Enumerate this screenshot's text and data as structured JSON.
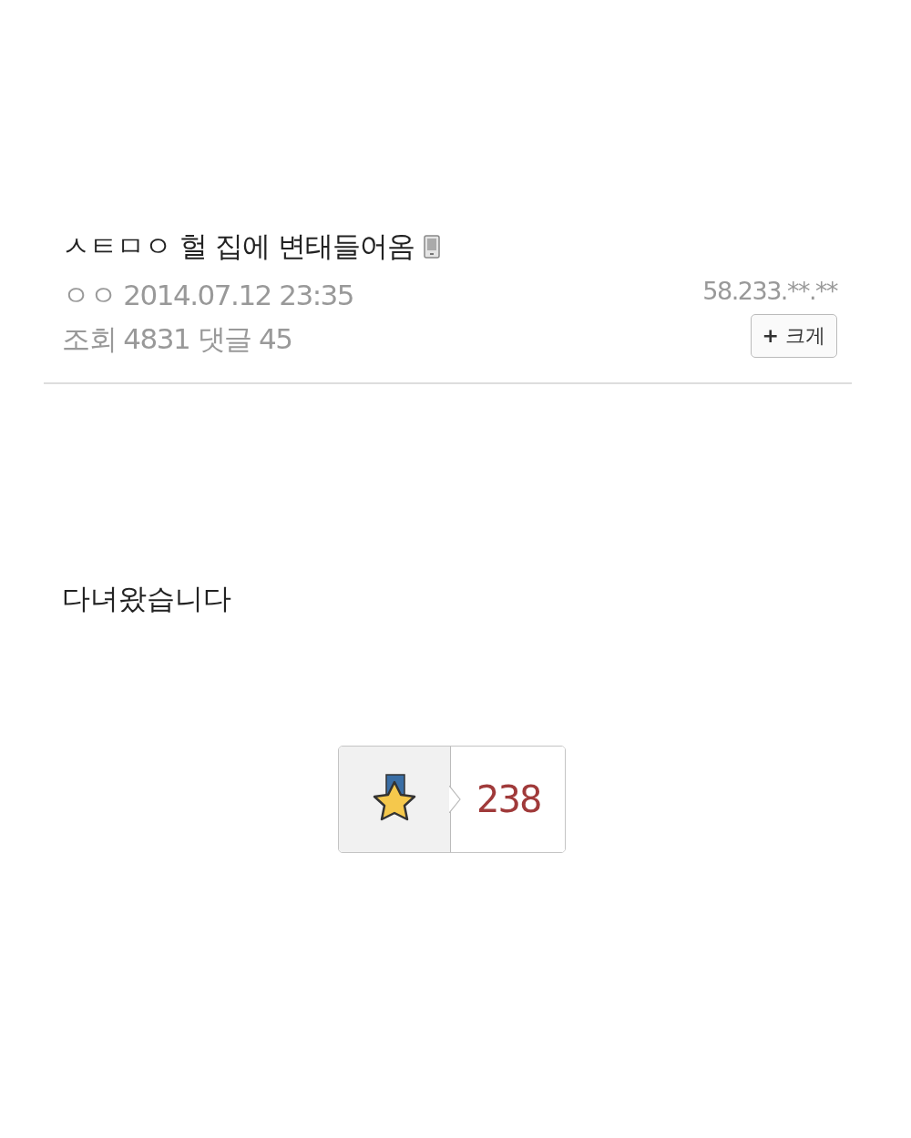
{
  "post": {
    "title": "ㅅㅌㅁㅇ 헐 집에 변태들어옴",
    "author": "ㅇㅇ",
    "date": "2014.07.12 23:35",
    "ip": "58.233.**.**",
    "views_label": "조회",
    "views": "4831",
    "comments_label": "댓글",
    "comments": "45",
    "enlarge_button": {
      "icon": "+",
      "label": "크게"
    }
  },
  "body": "다녀왔습니다",
  "recommend": {
    "count": "238"
  }
}
